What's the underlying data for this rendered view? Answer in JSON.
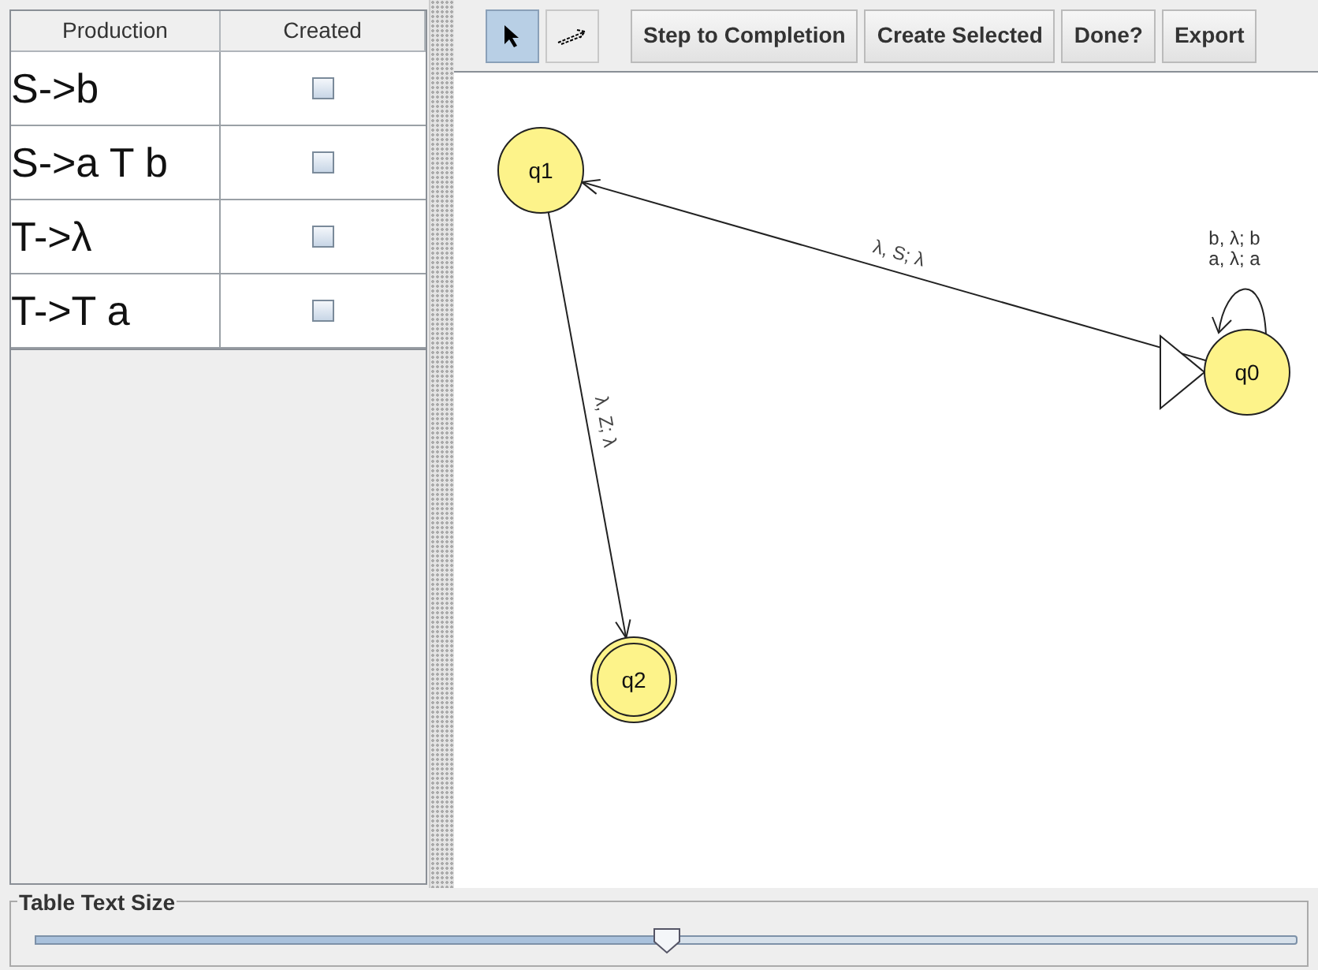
{
  "table": {
    "columns": [
      "Production",
      "Created"
    ],
    "rows": [
      {
        "production": "S->b",
        "created": false
      },
      {
        "production": "S->a T b",
        "created": false
      },
      {
        "production": "T->λ",
        "created": false
      },
      {
        "production": "T->T a",
        "created": false
      }
    ]
  },
  "toolbar": {
    "tools": [
      {
        "kind": "pointer",
        "selected": true
      },
      {
        "kind": "transition",
        "selected": false
      }
    ],
    "buttons": [
      "Step to Completion",
      "Create Selected",
      "Done?",
      "Export"
    ]
  },
  "diagram": {
    "states": [
      {
        "label": "q1",
        "initial": false,
        "final": false
      },
      {
        "label": "q0",
        "initial": true,
        "final": false
      },
      {
        "label": "q2",
        "initial": false,
        "final": true
      }
    ],
    "transitions": [
      {
        "labels": [
          "λ, S; λ"
        ]
      },
      {
        "labels": [
          "λ, Z; λ"
        ]
      },
      {
        "labels": [
          "b, λ; b",
          "a, λ; a"
        ]
      }
    ]
  },
  "text_size": {
    "title": "Table Text Size",
    "level": 0.5
  }
}
